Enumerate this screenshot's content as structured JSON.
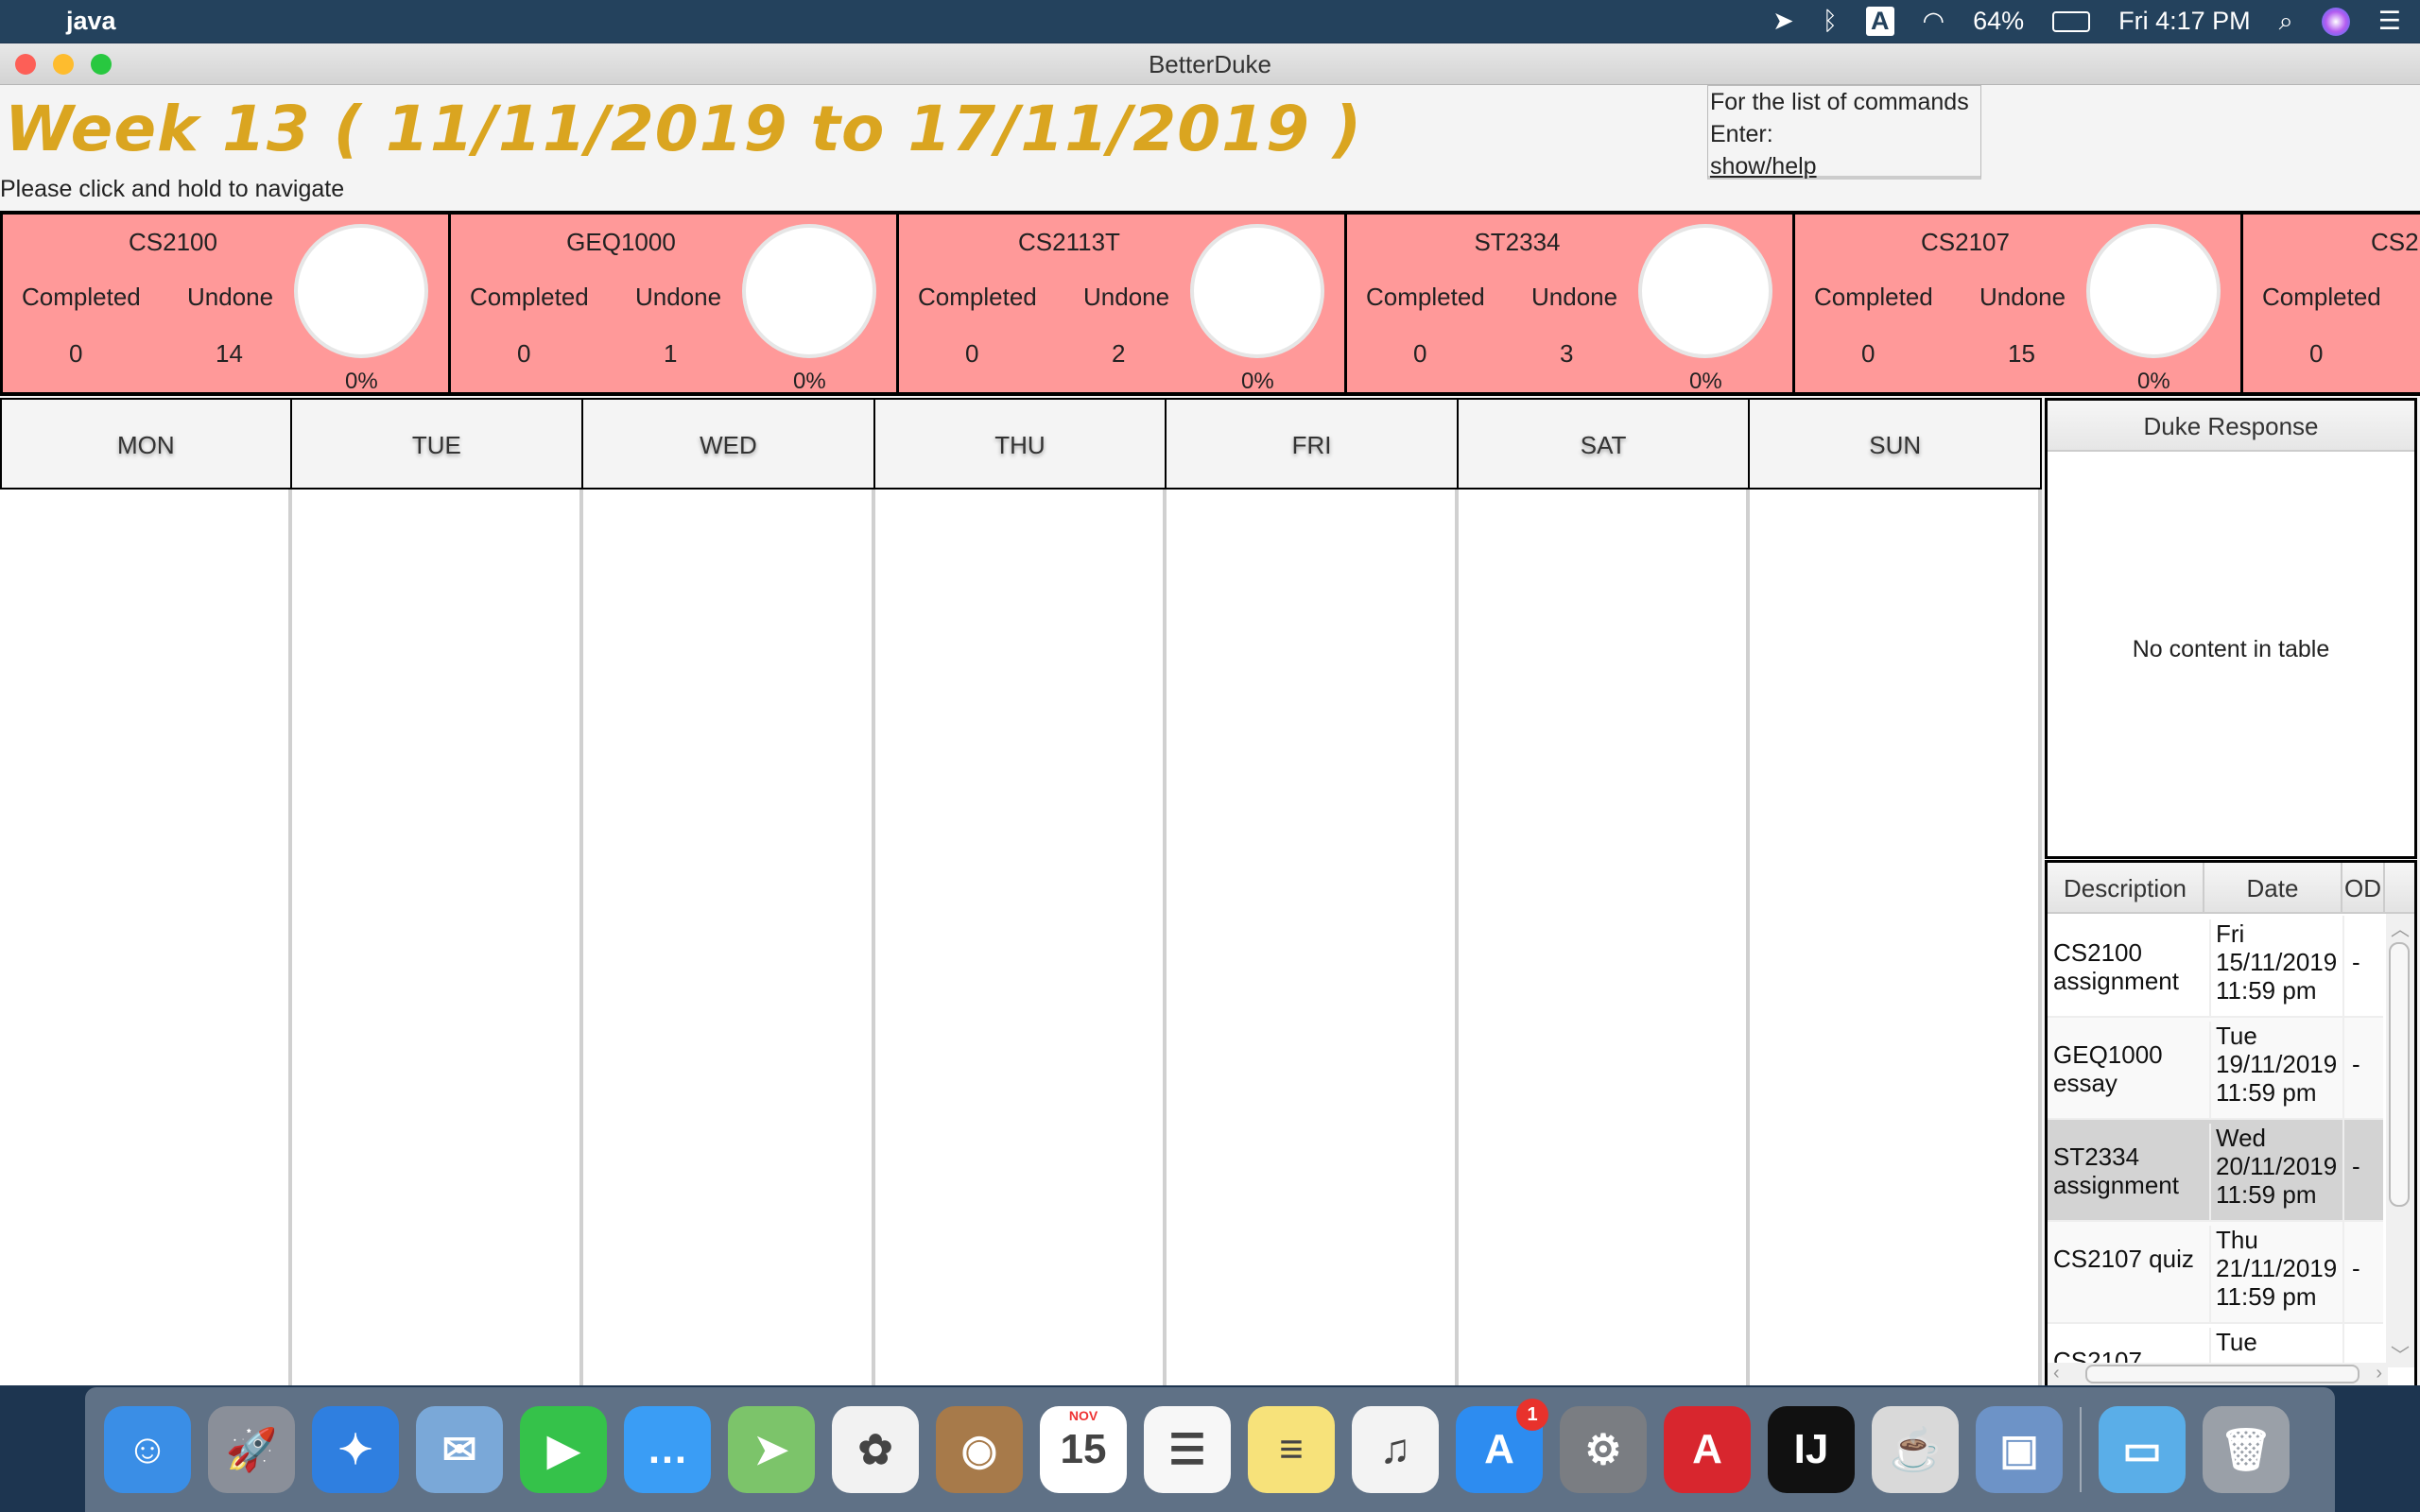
{
  "menubar": {
    "app": "java",
    "battery": "64%",
    "clock": "Fri 4:17 PM",
    "input_source": "A"
  },
  "window": {
    "title": "BetterDuke"
  },
  "header": {
    "title": "Week 13 ( 11/11/2019 to 17/11/2019 )",
    "hint": "Please click and hold to navigate",
    "commands": {
      "line1": "For the list of commands",
      "line2": "Enter:",
      "line3": "show/help"
    }
  },
  "cards": [
    {
      "module": "CS2100",
      "completed_label": "Completed",
      "undone_label": "Undone",
      "completed": "0",
      "undone": "14",
      "percent": "0%"
    },
    {
      "module": "GEQ1000",
      "completed_label": "Completed",
      "undone_label": "Undone",
      "completed": "0",
      "undone": "1",
      "percent": "0%"
    },
    {
      "module": "CS2113T",
      "completed_label": "Completed",
      "undone_label": "Undone",
      "completed": "0",
      "undone": "2",
      "percent": "0%"
    },
    {
      "module": "ST2334",
      "completed_label": "Completed",
      "undone_label": "Undone",
      "completed": "0",
      "undone": "3",
      "percent": "0%"
    },
    {
      "module": "CS2107",
      "completed_label": "Completed",
      "undone_label": "Undone",
      "completed": "0",
      "undone": "15",
      "percent": "0%"
    },
    {
      "module": "CS2",
      "completed_label": "Completed",
      "undone_label": "",
      "completed": "0",
      "undone": "",
      "percent": ""
    }
  ],
  "days": [
    "MON",
    "TUE",
    "WED",
    "THU",
    "FRI",
    "SAT",
    "SUN"
  ],
  "duke": {
    "header": "Duke Response",
    "empty": "No content in table"
  },
  "table": {
    "columns": [
      "Description",
      "Date",
      "OD"
    ],
    "rows": [
      {
        "desc": "CS2100 assignment",
        "date": "Fri 15/11/2019 11:59 pm",
        "od": "-",
        "selected": false
      },
      {
        "desc": "GEQ1000 essay",
        "date": "Tue 19/11/2019 11:59 pm",
        "od": "-",
        "selected": false
      },
      {
        "desc": "ST2334 assignment",
        "date": "Wed 20/11/2019 11:59 pm",
        "od": "-",
        "selected": true
      },
      {
        "desc": "CS2107 quiz",
        "date": "Thu 21/11/2019 11:59 pm",
        "od": "-",
        "selected": false
      },
      {
        "desc": "CS2107",
        "date": "Tue",
        "od": "",
        "selected": false
      }
    ]
  },
  "colors": {
    "title": "#daa520",
    "card": "#ff9999",
    "selected_row": "#d3d3d3"
  },
  "dock": [
    {
      "name": "finder",
      "color": "#3a8ee6",
      "glyph": "☺"
    },
    {
      "name": "launchpad",
      "color": "#8a8f99",
      "glyph": "🚀"
    },
    {
      "name": "safari",
      "color": "#2f7fe0",
      "glyph": "✦"
    },
    {
      "name": "mail",
      "color": "#7aa8d8",
      "glyph": "✉"
    },
    {
      "name": "facetime",
      "color": "#35c24a",
      "glyph": "▶"
    },
    {
      "name": "messages",
      "color": "#3a9df5",
      "glyph": "…"
    },
    {
      "name": "maps",
      "color": "#7cc46a",
      "glyph": "➤"
    },
    {
      "name": "photos",
      "color": "#f2f2f2",
      "glyph": "✿"
    },
    {
      "name": "contacts",
      "color": "#a77a4a",
      "glyph": "◉"
    },
    {
      "name": "calendar",
      "color": "#ffffff",
      "glyph": "15",
      "label": "NOV"
    },
    {
      "name": "reminders",
      "color": "#f7f7f7",
      "glyph": "☰"
    },
    {
      "name": "notes",
      "color": "#f7e27a",
      "glyph": "≡"
    },
    {
      "name": "itunes",
      "color": "#f3f3f3",
      "glyph": "♫"
    },
    {
      "name": "app-store",
      "color": "#2d8cf0",
      "glyph": "A",
      "badge": "1"
    },
    {
      "name": "system-preferences",
      "color": "#7a7d82",
      "glyph": "⚙"
    },
    {
      "name": "angular",
      "color": "#d8262e",
      "glyph": "A"
    },
    {
      "name": "intellij",
      "color": "#111111",
      "glyph": "IJ"
    },
    {
      "name": "java",
      "color": "#d9d9d9",
      "glyph": "☕"
    },
    {
      "name": "preview",
      "color": "#6d93c7",
      "glyph": "▣"
    },
    {
      "name": "downloads-folder",
      "color": "#5aaee8",
      "glyph": "▭"
    },
    {
      "name": "trash",
      "color": "#9aa0a8",
      "glyph": "🗑"
    }
  ]
}
